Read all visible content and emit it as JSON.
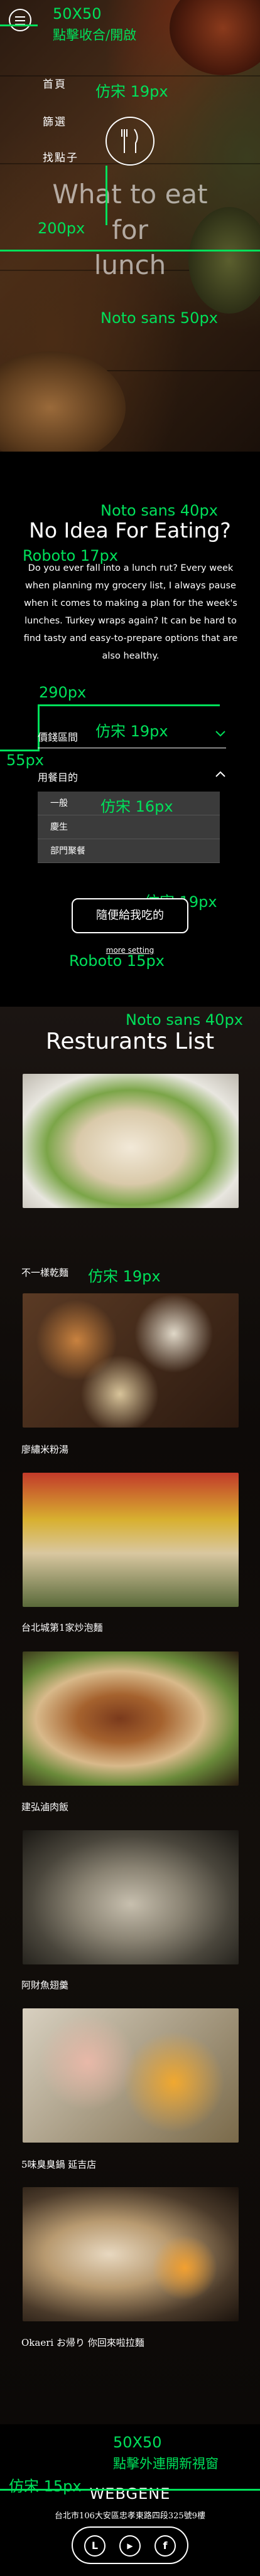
{
  "hero": {
    "menu_note": "50X50",
    "menu_note2": "點擊收合/開啟",
    "nav": [
      "首頁",
      "篩選",
      "找點子"
    ],
    "nav_font_note": "仿宋 19px",
    "title_lines": [
      "What to eat",
      "for",
      "lunch"
    ],
    "title_font_note": "Noto sans 50px",
    "spacing_note": "200px"
  },
  "intro": {
    "title_font_note": "Noto sans 40px",
    "title": "No Idea For Eating?",
    "body_font_note": "Roboto 17px",
    "body": "Do you ever fall into a lunch rut? Every week when planning my grocery list, I always pause when it comes to making a plan for the week's lunches. Turkey wraps again? It can be hard to find tasty and easy-to-prepare options that are also healthy."
  },
  "filters": {
    "width_note": "290px",
    "left_note": "55px",
    "select_font_note": "仿宋 19px",
    "district_label": "價錢區間",
    "purpose_label": "用餐目的",
    "options": [
      "一般",
      "慶生",
      "部門聚餐"
    ],
    "options_font_note": "仿宋 16px",
    "random_font_note": "仿宋 19px",
    "random_button": "隨便給我吃的",
    "more_font_note": "Roboto 15px",
    "more_settings": "more setting"
  },
  "restaurants": {
    "title_font_note": "Noto sans 40px",
    "title": "Resturants List",
    "name_font_note": "仿宋 19px",
    "items": [
      {
        "name": "不一樣乾麵"
      },
      {
        "name": "廖繡米粉湯"
      },
      {
        "name": "台北城第1家炒泡麵"
      },
      {
        "name": "建弘滷肉飯"
      },
      {
        "name": "阿財魚翅羹"
      },
      {
        "name": "5味臭臭鍋 延吉店"
      },
      {
        "name": "Okaeri お帰り 你回來啦拉麵"
      }
    ]
  },
  "footer": {
    "link_note": "50X50",
    "link_note2": "點擊外連開新視窗",
    "brand_font_note": "仿宋 15px",
    "brand": "WEBGENE",
    "address": "台北市106大安區忠孝東路四段325號9樓",
    "social_icons": [
      "line-icon",
      "youtube-icon",
      "facebook-icon"
    ],
    "social_glyphs": [
      "L",
      "▶",
      "f"
    ]
  },
  "colors": {
    "annotation": "#00e05a",
    "background": "#000000"
  }
}
